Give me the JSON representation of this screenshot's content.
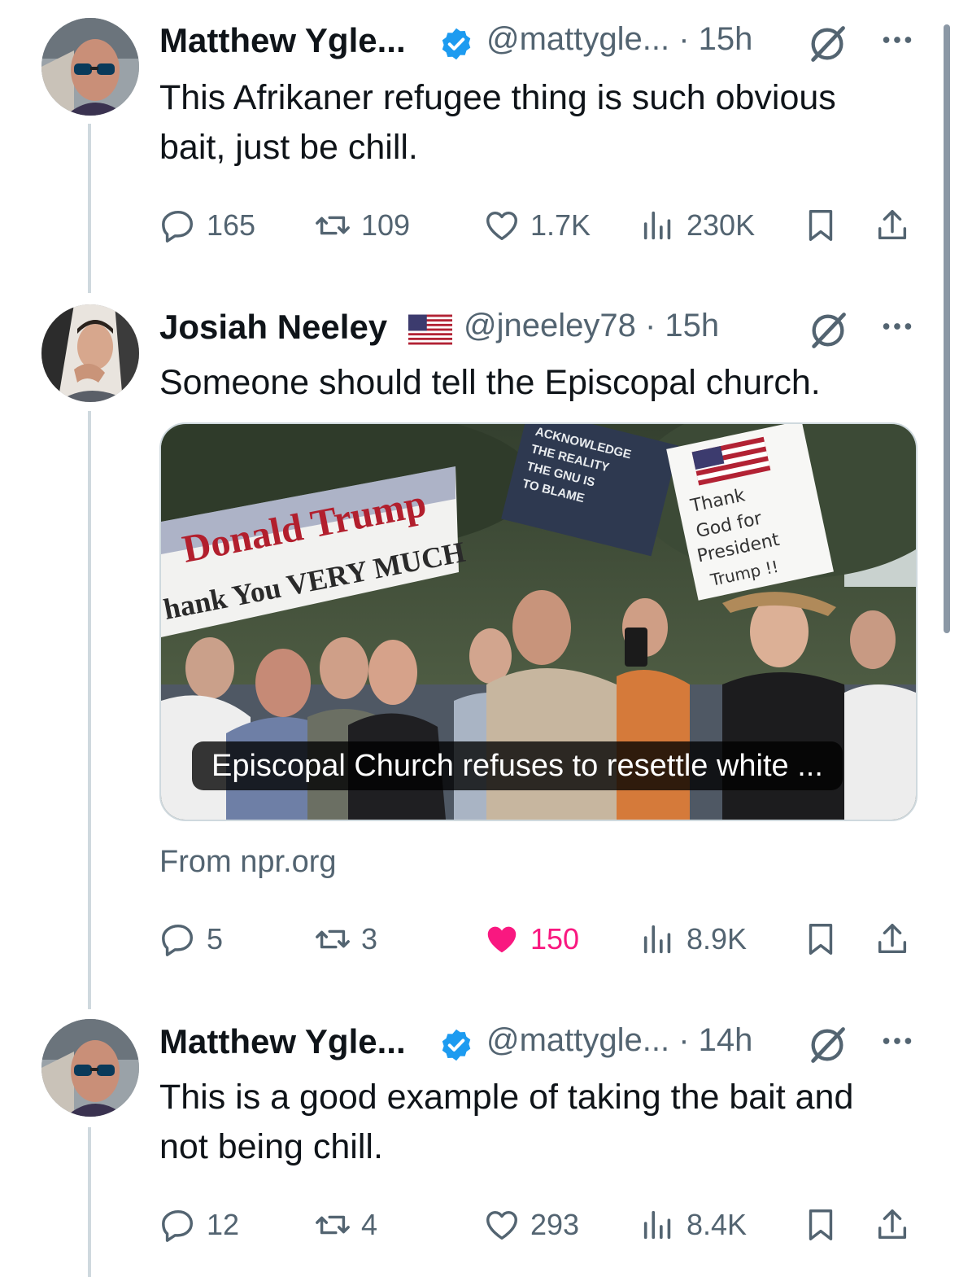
{
  "tweets": [
    {
      "name": "Matthew Ygle...",
      "handle_time": "@mattygle... · 15h",
      "text": "This Afrikaner refugee thing is such obvious bait, just be chill.",
      "replies": "165",
      "reposts": "109",
      "likes": "1.7K",
      "views": "230K",
      "liked": false
    },
    {
      "name": "Josiah Neeley",
      "handle_time": "@jneeley78 · 15h",
      "text": "Someone should tell the Episcopal church.",
      "card": {
        "caption": "Episcopal Church refuses to resettle white ...",
        "source": "From npr.org",
        "signs": {
          "banner_line1": "Donald Trump",
          "banner_line2": "hank You VERY MUCH",
          "dark_sign": [
            "ACKNOWLEDGE",
            "THE REALITY",
            "THE GNU IS",
            "TO BLAME"
          ],
          "white_sign": [
            "Thank",
            "God for",
            "President",
            "Trump !!"
          ]
        }
      },
      "replies": "5",
      "reposts": "3",
      "likes": "150",
      "views": "8.9K",
      "liked": true
    },
    {
      "name": "Matthew Ygle...",
      "handle_time": "@mattygle... · 14h",
      "text": "This is a good example of taking the bait and not being chill.",
      "replies": "12",
      "reposts": "4",
      "likes": "293",
      "views": "8.4K",
      "liked": false
    }
  ],
  "colors": {
    "text": "#0f1419",
    "secondary": "#536471",
    "verified": "#1d9bf0",
    "like": "#f91880",
    "thread_line": "#cfd9de"
  },
  "icons": [
    "verified-badge-icon",
    "flag-us-icon",
    "grok-icon",
    "more-icon",
    "reply-icon",
    "repost-icon",
    "like-icon",
    "views-icon",
    "bookmark-icon",
    "share-icon"
  ]
}
